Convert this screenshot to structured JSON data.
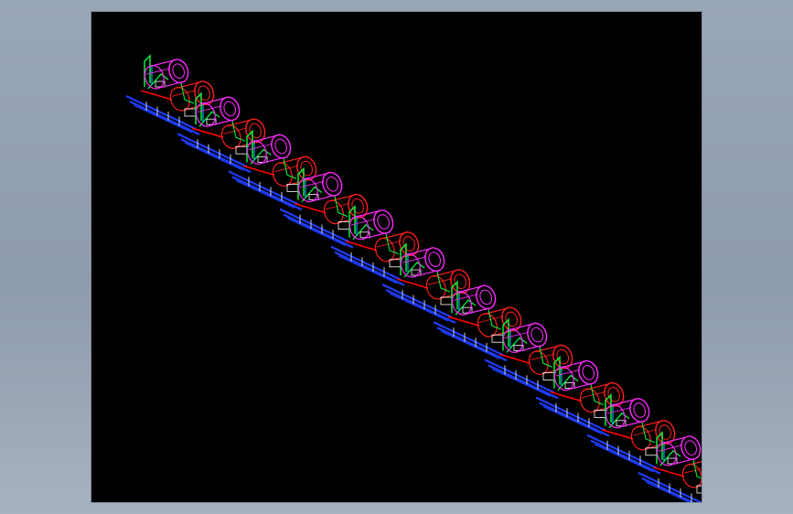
{
  "app": {
    "background_gradient_top": "#9aa7b8",
    "background_gradient_bottom": "#a6b2c1"
  },
  "viewport": {
    "background": "#000000"
  },
  "drawing": {
    "description": "",
    "colors": {
      "cylinder_primary": "#ff1f1f",
      "cylinder_secondary": "#ff2bff",
      "frame_primary": "#00ff40",
      "frame_secondary": "#00c8ff",
      "base_rail": "#1f3dff",
      "detail": "#ffffff",
      "accent": "#ff0000"
    },
    "assemblies": [
      {
        "id": 1
      },
      {
        "id": 2
      },
      {
        "id": 3
      },
      {
        "id": 4
      },
      {
        "id": 5
      },
      {
        "id": 6
      },
      {
        "id": 7
      },
      {
        "id": 8
      },
      {
        "id": 9
      },
      {
        "id": 10
      },
      {
        "id": 11
      }
    ]
  }
}
